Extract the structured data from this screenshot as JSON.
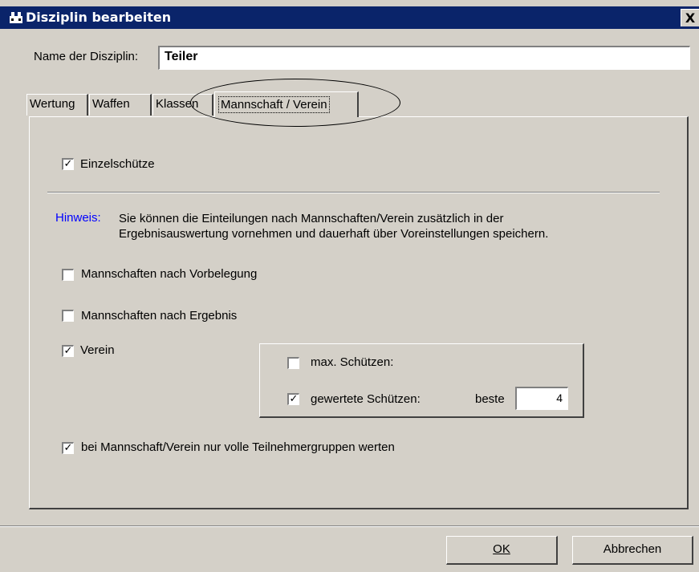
{
  "window": {
    "title": "Disziplin bearbeiten",
    "close_label": "X",
    "icon": "app-icon"
  },
  "name_field": {
    "label": "Name der Disziplin:",
    "value": "Teiler"
  },
  "tabs": [
    {
      "label": "Wertung",
      "active": false
    },
    {
      "label": "Waffen",
      "active": false
    },
    {
      "label": "Klassen",
      "active": false
    },
    {
      "label": "Mannschaft / Verein",
      "active": true
    }
  ],
  "panel": {
    "einzelschuetze": {
      "label": "Einzelschütze",
      "checked": true
    },
    "hint": {
      "label": "Hinweis:",
      "text": "Sie können die Einteilungen nach Mannschaften/Verein zusätzlich in der Ergebnisauswertung vornehmen und dauerhaft über Voreinstellungen speichern.",
      "label_color": "#0000ff"
    },
    "options": {
      "vorbelegung": {
        "label": "Mannschaften nach Vorbelegung",
        "checked": false
      },
      "ergebnis": {
        "label": "Mannschaften nach Ergebnis",
        "checked": false
      },
      "verein": {
        "label": "Verein",
        "checked": true
      },
      "volle_gruppen": {
        "label": "bei Mannschaft/Verein nur volle Teilnehmergruppen werten",
        "checked": true
      }
    },
    "verein_group": {
      "max_schuetzen": {
        "label": "max. Schützen:",
        "checked": false
      },
      "gewertete_schuetzen": {
        "label": "gewertete Schützen:",
        "checked": true
      },
      "beste_label": "beste",
      "beste_value": "4"
    }
  },
  "buttons": {
    "ok_label": "OK",
    "cancel_label": "Abbrechen"
  },
  "colors": {
    "titlebar": "#0a246a",
    "dialog_bg": "#d4d0c8"
  }
}
